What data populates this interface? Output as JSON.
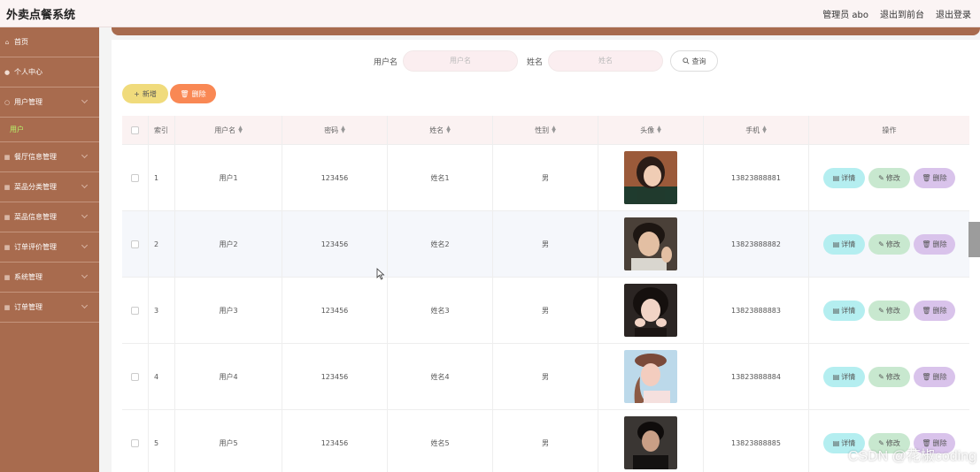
{
  "app": {
    "title": "外卖点餐系统"
  },
  "topbar": {
    "admin": "管理员 abo",
    "to_front": "退出到前台",
    "logout": "退出登录"
  },
  "sidebar": {
    "items": [
      {
        "label": "首页",
        "icon": "home-icon"
      },
      {
        "label": "个人中心",
        "icon": "person-icon"
      },
      {
        "label": "用户管理",
        "icon": "user-mgmt-icon",
        "expanded": true,
        "sub": "用户"
      },
      {
        "label": "餐厅信息管理",
        "icon": "grid-icon"
      },
      {
        "label": "菜品分类管理",
        "icon": "grid-icon"
      },
      {
        "label": "菜品信息管理",
        "icon": "grid-icon"
      },
      {
        "label": "订单评价管理",
        "icon": "grid-icon"
      },
      {
        "label": "系统管理",
        "icon": "grid-icon"
      },
      {
        "label": "订单管理",
        "icon": "grid-icon"
      }
    ]
  },
  "search": {
    "username_label": "用户名",
    "username_placeholder": "用户名",
    "name_label": "姓名",
    "name_placeholder": "姓名",
    "query_label": "查询"
  },
  "actions": {
    "add": "新增",
    "delete": "删除"
  },
  "table": {
    "headers": [
      "索引",
      "用户名",
      "密码",
      "姓名",
      "性别",
      "头像",
      "手机",
      "操作"
    ],
    "rows": [
      {
        "index": "1",
        "username": "用户1",
        "password": "123456",
        "name": "姓名1",
        "gender": "男",
        "phone": "13823888881"
      },
      {
        "index": "2",
        "username": "用户2",
        "password": "123456",
        "name": "姓名2",
        "gender": "男",
        "phone": "13823888882"
      },
      {
        "index": "3",
        "username": "用户3",
        "password": "123456",
        "name": "姓名3",
        "gender": "男",
        "phone": "13823888883"
      },
      {
        "index": "4",
        "username": "用户4",
        "password": "123456",
        "name": "姓名4",
        "gender": "男",
        "phone": "13823888884"
      },
      {
        "index": "5",
        "username": "用户5",
        "password": "123456",
        "name": "姓名5",
        "gender": "男",
        "phone": "13823888885"
      }
    ],
    "op_detail": "详情",
    "op_edit": "修改",
    "op_delete": "删除"
  },
  "watermark": "CSDN @花椒coding",
  "colors": {
    "sidebar": "#a86b4e",
    "active_sub": "#b8f56a",
    "add": "#f0db7c",
    "delete": "#f98854"
  }
}
